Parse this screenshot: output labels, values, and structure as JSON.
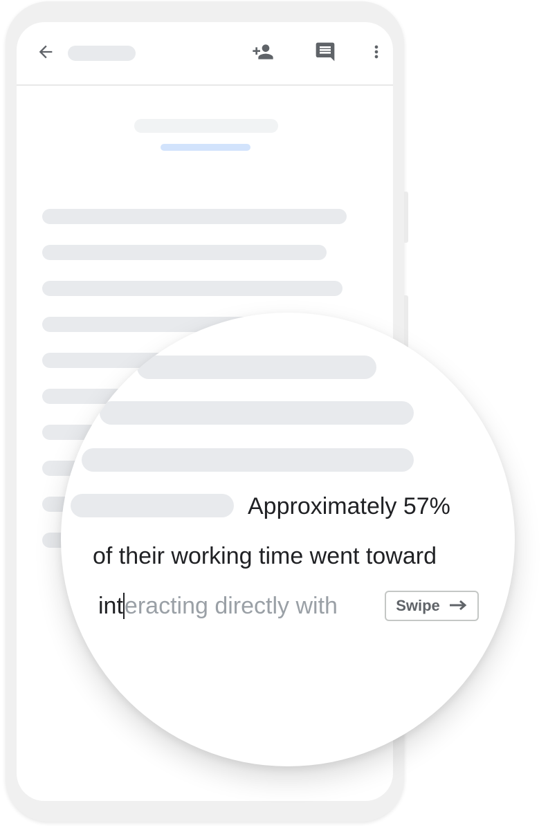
{
  "toolbar": {
    "icons": {
      "back": "arrow-back-icon",
      "add_user": "person-add-icon",
      "comment": "comment-icon",
      "more": "more-vert-icon"
    }
  },
  "magnifier": {
    "line1": "Approximately 57%",
    "line2": "of their working time went toward",
    "typed_text": "int",
    "suggestion_text": "eracting directly with",
    "swipe_label": "Swipe",
    "swipe_icon": "arrow-right-icon"
  },
  "colors": {
    "text": "#202124",
    "suggestion": "#9aa0a6",
    "placeholder": "#e8eaed",
    "accent_underline": "#d2e3fc",
    "icon": "#5f6368"
  }
}
